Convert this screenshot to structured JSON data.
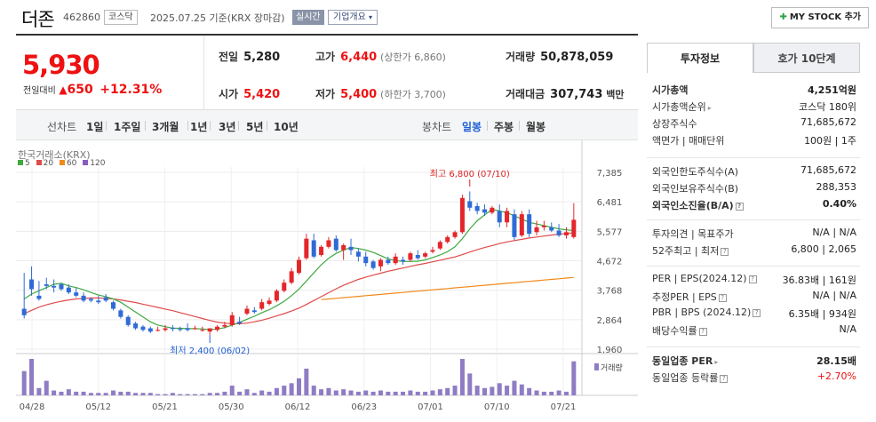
{
  "header": {
    "name": "더존",
    "code": "462860",
    "market": "코스닥",
    "date": "2025.07.25 기준(KRX 장마감)",
    "realtime": "실시간",
    "corp_info": "기업개요",
    "my_stock": "MY STOCK 추가"
  },
  "summary": {
    "price": "5,930",
    "change_label": "전일대비",
    "change": "650",
    "change_pct": "+12.31%",
    "prev_label": "전일",
    "prev": "5,280",
    "high_label": "고가",
    "high": "6,440",
    "upper": "(상한가 6,860)",
    "volume_label": "거래량",
    "volume": "50,878,059",
    "open_label": "시가",
    "open": "5,420",
    "low_label": "저가",
    "low": "5,400",
    "lower": "(하한가 3,700)",
    "amount_label": "거래대금",
    "amount": "307,743",
    "amount_unit": "백만"
  },
  "period": {
    "label": "선차트",
    "items": [
      "1일",
      "1주일",
      "3개월",
      "1년",
      "3년",
      "5년",
      "10년"
    ],
    "candle_label": "봉차트",
    "candle_items": [
      "일봉",
      "주봉",
      "월봉"
    ],
    "active_candle": "일봉"
  },
  "chart_data": {
    "type": "candlestick",
    "exchange": "한국거래소(KRX)",
    "ma_legend": [
      {
        "name": "5",
        "color": "#3fa93f"
      },
      {
        "name": "20",
        "color": "#e04a4a"
      },
      {
        "name": "60",
        "color": "#f08a1c"
      },
      {
        "name": "120",
        "color": "#8a5cc2"
      }
    ],
    "y_ticks": [
      "7,385",
      "6,481",
      "5,577",
      "4,672",
      "3,768",
      "2,864",
      "1,960"
    ],
    "x_ticks": [
      "04/28",
      "05/12",
      "05/21",
      "05/30",
      "06/12",
      "06/23",
      "07/01",
      "07/10",
      "07/21"
    ],
    "ylim": [
      1960,
      7385
    ],
    "max_label": "최고 6,800 (07/10)",
    "min_label": "최저 2,400 (06/02)",
    "volume_label": "거래량",
    "candles": [
      [
        3200,
        4300,
        3000,
        2900
      ],
      [
        4100,
        4500,
        3800,
        3600
      ],
      [
        3600,
        4050,
        3500,
        3450
      ],
      [
        3950,
        4150,
        3900,
        3800
      ],
      [
        3900,
        4100,
        3850,
        3700
      ],
      [
        3950,
        4000,
        3800,
        3750
      ],
      [
        3850,
        3950,
        3700,
        3650
      ],
      [
        3700,
        3850,
        3600,
        3550
      ],
      [
        3600,
        3700,
        3450,
        3400
      ],
      [
        3500,
        3550,
        3450,
        3400
      ],
      [
        3450,
        3600,
        3400,
        3350
      ],
      [
        3550,
        3650,
        3450,
        3400
      ],
      [
        3400,
        3450,
        3200,
        3150
      ],
      [
        3150,
        3200,
        2950,
        2900
      ],
      [
        2950,
        3000,
        2700,
        2650
      ],
      [
        2750,
        2800,
        2600,
        2550
      ],
      [
        2650,
        2700,
        2550,
        2500
      ],
      [
        2600,
        2650,
        2500,
        2450
      ],
      [
        2550,
        2650,
        2550,
        2500
      ],
      [
        2550,
        2700,
        2600,
        2500
      ],
      [
        2620,
        2700,
        2580,
        2500
      ],
      [
        2580,
        2650,
        2550,
        2500
      ],
      [
        2600,
        2750,
        2550,
        2500
      ],
      [
        2580,
        2680,
        2600,
        2550
      ],
      [
        2550,
        2650,
        2550,
        2500
      ],
      [
        2500,
        2600,
        2600,
        2400
      ],
      [
        2550,
        2700,
        2650,
        2500
      ],
      [
        2650,
        2800,
        2700,
        2600
      ],
      [
        2700,
        3100,
        3000,
        2650
      ],
      [
        2800,
        2950,
        2750,
        2700
      ],
      [
        3050,
        3300,
        3200,
        3000
      ],
      [
        3150,
        3250,
        3100,
        3050
      ],
      [
        3200,
        3500,
        3400,
        3150
      ],
      [
        3350,
        3550,
        3450,
        3300
      ],
      [
        3450,
        3800,
        3750,
        3400
      ],
      [
        3750,
        4100,
        4000,
        3700
      ],
      [
        4000,
        4450,
        4350,
        3950
      ],
      [
        4300,
        4800,
        4700,
        4250
      ],
      [
        4750,
        5500,
        5350,
        4700
      ],
      [
        5300,
        5500,
        4800,
        4750
      ],
      [
        4850,
        5150,
        5100,
        4800
      ],
      [
        5100,
        5400,
        5300,
        5050
      ],
      [
        5350,
        5450,
        5000,
        4950
      ],
      [
        5000,
        5200,
        5150,
        4700
      ],
      [
        5100,
        5350,
        5000,
        4850
      ],
      [
        4950,
        5050,
        4800,
        4650
      ],
      [
        4800,
        4950,
        4600,
        4500
      ],
      [
        4650,
        4700,
        4450,
        4400
      ],
      [
        4500,
        4750,
        4700,
        4350
      ],
      [
        4700,
        4800,
        4600,
        4550
      ],
      [
        4600,
        4900,
        4800,
        4550
      ],
      [
        4700,
        4800,
        4650,
        4550
      ],
      [
        4700,
        4950,
        4900,
        4650
      ],
      [
        4850,
        5000,
        4750,
        4700
      ],
      [
        4800,
        4950,
        4900,
        4750
      ],
      [
        4950,
        5100,
        5000,
        4900
      ],
      [
        5050,
        5300,
        5250,
        5000
      ],
      [
        5250,
        5450,
        5400,
        5200
      ],
      [
        5400,
        5600,
        5550,
        5350
      ],
      [
        5550,
        6700,
        6600,
        5500
      ],
      [
        6500,
        6800,
        6300,
        6200
      ],
      [
        6350,
        6450,
        6200,
        6100
      ],
      [
        6250,
        6400,
        6150,
        6050
      ],
      [
        6150,
        6350,
        6300,
        6100
      ],
      [
        6200,
        6400,
        5850,
        5700
      ],
      [
        5850,
        6300,
        6200,
        5700
      ],
      [
        6100,
        6250,
        5400,
        5300
      ],
      [
        5450,
        6200,
        6100,
        5400
      ],
      [
        6100,
        6250,
        5500,
        5400
      ],
      [
        5550,
        5900,
        5700,
        5450
      ],
      [
        5700,
        5900,
        5750,
        5600
      ],
      [
        5700,
        5850,
        5600,
        5550
      ],
      [
        5600,
        5800,
        5450,
        5400
      ],
      [
        5450,
        5700,
        5550,
        5350
      ],
      [
        5400,
        6440,
        5930,
        5350
      ]
    ],
    "ma5": [
      3500,
      3650,
      3750,
      3850,
      3950,
      3980,
      3900,
      3850,
      3780,
      3700,
      3620,
      3570,
      3500,
      3400,
      3250,
      3100,
      2950,
      2800,
      2700,
      2650,
      2600,
      2600,
      2590,
      2590,
      2580,
      2560,
      2580,
      2620,
      2700,
      2780,
      2880,
      2970,
      3080,
      3170,
      3290,
      3430,
      3600,
      3800,
      4050,
      4300,
      4550,
      4750,
      4900,
      5000,
      5080,
      5050,
      5000,
      4930,
      4830,
      4730,
      4680,
      4650,
      4650,
      4660,
      4700,
      4770,
      4850,
      4950,
      5100,
      5350,
      5650,
      5900,
      6080,
      6250,
      6200,
      6150,
      6050,
      5950,
      5850,
      5800,
      5750,
      5700,
      5650,
      5620,
      5600
    ],
    "ma20": [
      3050,
      3150,
      3250,
      3320,
      3380,
      3430,
      3470,
      3500,
      3520,
      3530,
      3530,
      3520,
      3500,
      3470,
      3430,
      3390,
      3340,
      3290,
      3240,
      3190,
      3140,
      3080,
      3020,
      2960,
      2900,
      2840,
      2790,
      2760,
      2740,
      2740,
      2760,
      2800,
      2850,
      2910,
      2980,
      3050,
      3130,
      3220,
      3330,
      3450,
      3570,
      3690,
      3810,
      3920,
      4010,
      4100,
      4170,
      4230,
      4290,
      4350,
      4400,
      4450,
      4500,
      4550,
      4590,
      4640,
      4690,
      4740,
      4790,
      4860,
      4940,
      5010,
      5080,
      5140,
      5200,
      5250,
      5290,
      5330,
      5370,
      5400,
      5430,
      5460,
      5490,
      5510,
      5530
    ],
    "ma60": [
      null,
      null,
      null,
      null,
      null,
      null,
      null,
      null,
      null,
      null,
      null,
      null,
      null,
      null,
      null,
      null,
      null,
      null,
      null,
      null,
      null,
      null,
      null,
      null,
      null,
      null,
      null,
      null,
      null,
      null,
      null,
      null,
      null,
      null,
      null,
      null,
      null,
      null,
      null,
      null,
      3480,
      3500,
      3520,
      3540,
      3560,
      3580,
      3600,
      3620,
      3640,
      3660,
      3680,
      3700,
      3720,
      3740,
      3760,
      3780,
      3800,
      3820,
      3840,
      3860,
      3880,
      3900,
      3920,
      3940,
      3960,
      3980,
      4000,
      4020,
      4040,
      4060,
      4080,
      4100,
      4120,
      4140,
      4160
    ],
    "volume": [
      20,
      30,
      6,
      12,
      4,
      3,
      5,
      3,
      3,
      2,
      2,
      2,
      4,
      3,
      3,
      2,
      2,
      2,
      1,
      1,
      2,
      1,
      1,
      1,
      1,
      2,
      2,
      3,
      8,
      3,
      5,
      2,
      4,
      3,
      6,
      8,
      10,
      14,
      22,
      8,
      5,
      6,
      4,
      5,
      4,
      3,
      4,
      3,
      4,
      3,
      3,
      3,
      4,
      3,
      3,
      4,
      5,
      6,
      8,
      30,
      18,
      8,
      6,
      7,
      10,
      8,
      12,
      9,
      6,
      4,
      3,
      3,
      4,
      3,
      28
    ]
  },
  "invest": {
    "tab1": "투자정보",
    "tab2": "호가 10단계",
    "rows1": [
      {
        "k": "시가총액",
        "v": "4,251억원",
        "bold": true
      },
      {
        "k": "시가총액순위",
        "v": "코스닥 180위",
        "arr": true
      },
      {
        "k": "상장주식수",
        "v": "71,685,672"
      },
      {
        "k": "액면가 | 매매단위",
        "v": "100원 | 1주"
      }
    ],
    "rows2": [
      {
        "k": "외국인한도주식수(A)",
        "v": "71,685,672"
      },
      {
        "k": "외국인보유주식수(B)",
        "v": "288,353"
      },
      {
        "k": "외국인소진율(B/A)",
        "v": "0.40%",
        "bold": true,
        "hint": true
      }
    ],
    "rows3": [
      {
        "k": "투자의견 | 목표주가",
        "v": "N/A | N/A"
      },
      {
        "k": "52주최고 | 최저",
        "v": "6,800 | 2,065",
        "hint": true
      }
    ],
    "rows4": [
      {
        "k": "PER | EPS(2024.12)",
        "v": "36.83배 | 161원",
        "hint": true
      },
      {
        "k": "추정PER | EPS",
        "v": "N/A | N/A",
        "hint": true
      },
      {
        "k": "PBR | BPS (2024.12)",
        "v": "6.35배 | 934원",
        "hint": true
      },
      {
        "k": "배당수익률",
        "v": "N/A",
        "hint": true
      }
    ],
    "rows5": [
      {
        "k": "동일업종 PER",
        "v": "28.15배",
        "bold": true,
        "arr": true
      },
      {
        "k": "동일업종 등락률",
        "v": "+2.70%",
        "red": true,
        "hint": true
      }
    ]
  }
}
